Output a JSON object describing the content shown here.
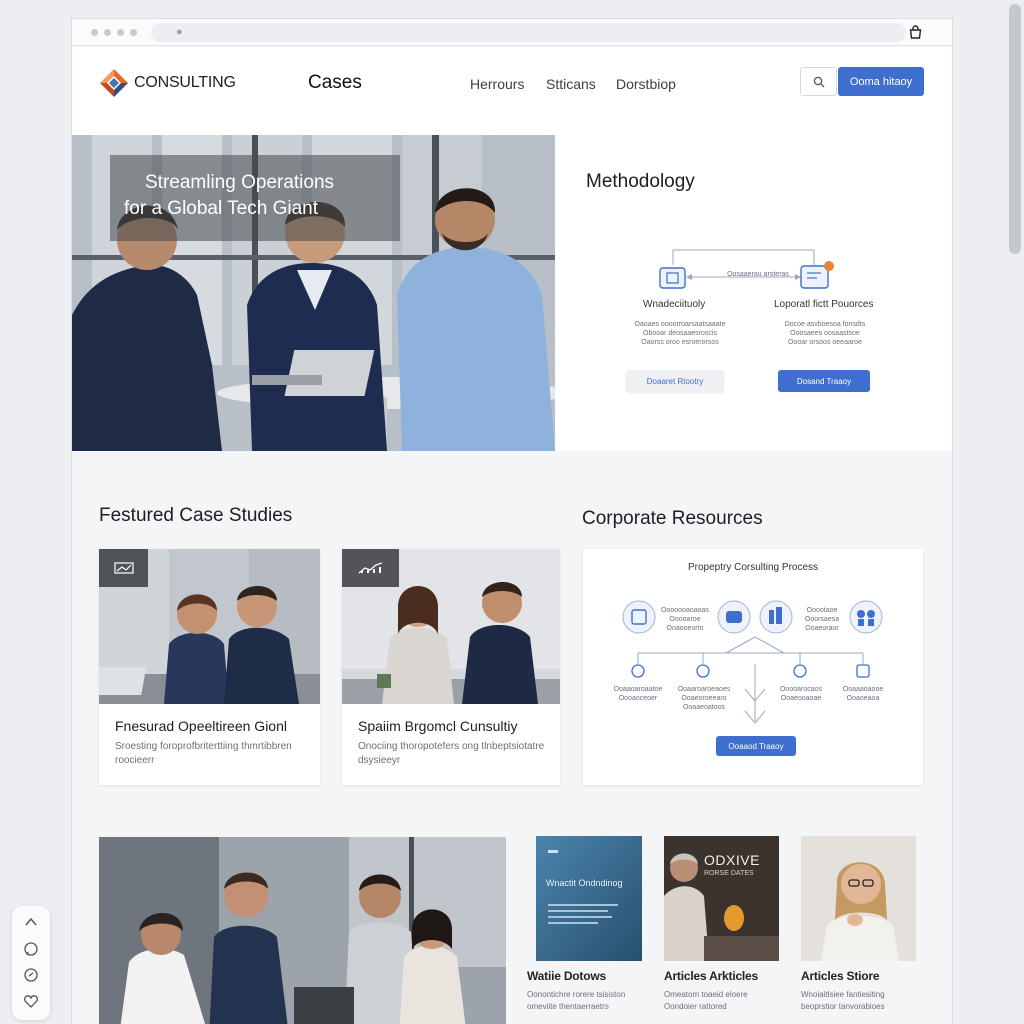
{
  "brand": {
    "name": "CONSULTING"
  },
  "nav": {
    "cases": "Cases",
    "links": [
      "Herrours",
      "Stticans",
      "Dorstbiop"
    ],
    "cta_label": "Ooma hitaoy"
  },
  "hero": {
    "caption_line1": "Streamling Operations",
    "caption_line2": "for a Global Tech Giant"
  },
  "methodology": {
    "title": "Methodology",
    "mini_heading": "Oosaaerau arsteras",
    "left": {
      "label": "Wnadeciituoly",
      "fine_lines": [
        "Oaoaes oooorroarsaatsaaate",
        "Obooar deosaaesroscis",
        "Oaorss oroo esroerorsos"
      ],
      "button": "Doaaret Rtootry"
    },
    "right": {
      "label": "Loporatl fictt Pouorces",
      "fine_lines": [
        "Docoe asvboesoa fonsdts",
        "Ooosaees oosaastsoe",
        "Oooar orsoos oeeaaroe"
      ],
      "button": "Dosand Traaoy"
    }
  },
  "featured": {
    "title": "Festured Case Studies",
    "cards": [
      {
        "title": "Fnesurad Opeeltireen Gionl",
        "desc": "Sroesting foroprofbriterttiing thmrtibbren roocieerr"
      },
      {
        "title": "Spaiim Brgomcl Cunsultiy",
        "desc": "Onociing thoropotefers ong tlnbeptsiotatre dsysieeyr"
      }
    ]
  },
  "resources": {
    "title": "Corporate Resources",
    "panel_title": "Propeptry Corsulting Process",
    "top_labels": [
      "Ooooooaoaoas",
      "Ooooaroe",
      "Ooaooeorto"
    ],
    "right_labels": [
      "Ooootaoe",
      "Ooorsaesa",
      "Ooaeoraor"
    ],
    "bottom_labels": [
      [
        "Ooaaoaroaatoe",
        "Oooaoceoer"
      ],
      [
        "Ooaaroaroeaoes",
        "Ooaeoroeearo",
        "Ooaaeoatoos"
      ],
      [
        "Ooooarocaos",
        "Ooaeooaoae"
      ],
      [
        "Ooaaaoaooe",
        "Ooaoeaoa"
      ]
    ],
    "button": "Ooaaod Traaoy"
  },
  "tiles": [
    {
      "title": "Watiie Dotows",
      "desc": "Oonontichre rorere tsisiston omeviite thentaerraetrs",
      "cover_caption": "Wnactit Ondndinog"
    },
    {
      "title": "Articles Arkticles",
      "desc": "Omeatom toaeid eloere Oondoier rattored",
      "cover_caption": "ODXIVE",
      "cover_sub": "RORSE DATES"
    },
    {
      "title": "Articles Stiore",
      "desc": "Wnoiaitlsiee fantiesiting beoprstior tanvorabioes"
    }
  ],
  "colors": {
    "accent": "#3f6fce",
    "orange": "#e8823b",
    "logo_orange": "#e26b2e",
    "logo_blue": "#2d4f8e"
  },
  "icons": [
    "lock-icon",
    "bag-icon",
    "search-icon",
    "chevron-up-icon",
    "chat-icon",
    "share-icon",
    "heart-icon"
  ]
}
